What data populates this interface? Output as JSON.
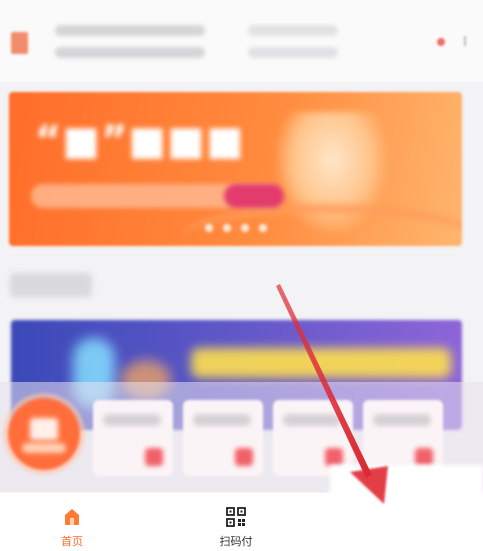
{
  "tabbar": {
    "home_label": "首页",
    "scan_label": "扫码付"
  },
  "colors": {
    "accent": "#ff6a2b",
    "annotation_arrow": "#e0303a"
  },
  "icons": {
    "home": "home-icon",
    "scan": "qr-code-icon"
  }
}
